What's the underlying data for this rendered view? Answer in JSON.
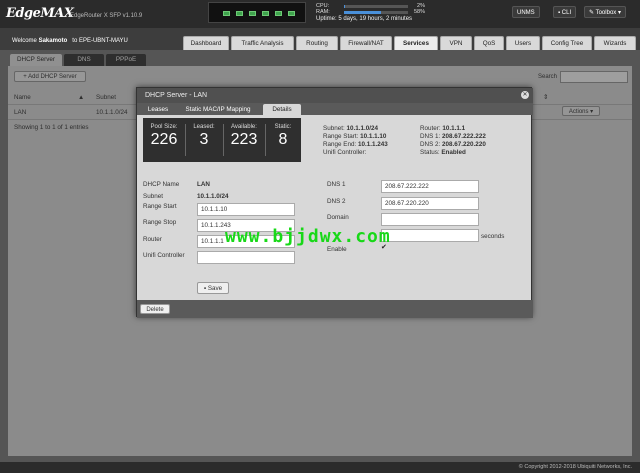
{
  "header": {
    "logo": "EdgeMAX",
    "model": "EdgeRouter X SFP v1.10.9",
    "cpu_label": "CPU:",
    "cpu_value": "2%",
    "cpu_fraction": 0.02,
    "ram_label": "RAM:",
    "ram_value": "58%",
    "ram_fraction": 0.58,
    "uptime": "Uptime: 5 days, 19 hours, 2 minutes",
    "unms_label": "UNMS",
    "cli_label": "CLI",
    "toolbox_label": "Toolbox"
  },
  "nav": {
    "welcome_prefix": "Welcome",
    "user": "Sakamoto",
    "to_text": "to EPE-UBNT-MAYU",
    "tabs": [
      "Dashboard",
      "Traffic Analysis",
      "Routing",
      "Firewall/NAT",
      "Services",
      "VPN",
      "QoS",
      "Users",
      "Config Tree",
      "Wizards"
    ]
  },
  "subtabs": [
    "DHCP Server",
    "DNS",
    "PPPoE"
  ],
  "list": {
    "add_label": "Add DHCP Server",
    "search_label": "Search",
    "col_name": "Name",
    "col_subnet": "Subnet",
    "row_name": "LAN",
    "row_subnet": "10.1.1.0/24",
    "actions_label": "Actions",
    "showing": "Showing 1 to 1 of 1 entries"
  },
  "modal": {
    "title": "DHCP Server - LAN",
    "tabs": [
      "Leases",
      "Static MAC/IP Mapping",
      "Details"
    ],
    "stats": {
      "pool_label": "Pool Size:",
      "pool_value": "226",
      "leased_label": "Leased:",
      "leased_value": "3",
      "avail_label": "Available:",
      "avail_value": "223",
      "static_label": "Static:",
      "static_value": "8"
    },
    "summary": {
      "subnet_label": "Subnet:",
      "subnet_value": "10.1.1.0/24",
      "range_start_label": "Range Start:",
      "range_start_value": "10.1.1.10",
      "range_end_label": "Range End:",
      "range_end_value": "10.1.1.243",
      "unifi_label": "Unifi Controller:",
      "router_label": "Router:",
      "router_value": "10.1.1.1",
      "dns1_label": "DNS 1:",
      "dns1_value": "208.67.222.222",
      "dns2_label": "DNS 2:",
      "dns2_value": "208.67.220.220",
      "status_label": "Status:",
      "status_value": "Enabled"
    },
    "form": {
      "name_label": "DHCP Name",
      "name_value": "LAN",
      "subnet_label": "Subnet",
      "subnet_value": "10.1.1.0/24",
      "range_start_label": "Range Start",
      "range_start_value": "10.1.1.10",
      "range_stop_label": "Range Stop",
      "range_stop_value": "10.1.1.243",
      "router_label": "Router",
      "router_value": "10.1.1.1",
      "unifi_label": "Unifi Controller",
      "unifi_value": "",
      "dns1_label": "DNS 1",
      "dns1_value": "208.67.222.222",
      "dns2_label": "DNS 2",
      "dns2_value": "208.67.220.220",
      "domain_label": "Domain",
      "domain_value": "",
      "lease_value": "",
      "seconds_label": "seconds",
      "enable_label": "Enable",
      "save_label": "Save"
    },
    "delete_label": "Delete"
  },
  "watermark": "www.bjjdwx.com",
  "footer": "© Copyright 2012-2018 Ubiquiti Networks, Inc."
}
